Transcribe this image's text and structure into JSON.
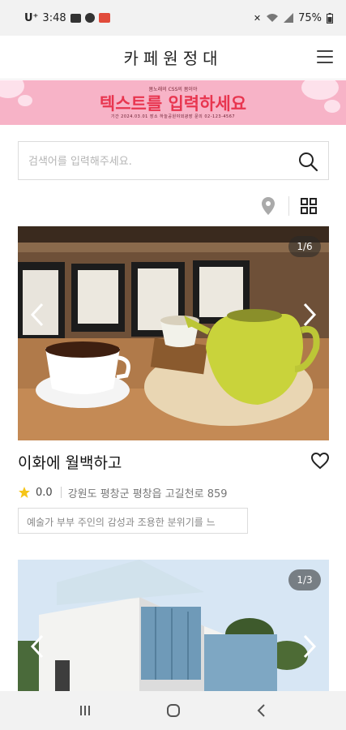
{
  "status_bar": {
    "carrier": "U⁺",
    "time": "3:48",
    "battery": "75%"
  },
  "app": {
    "title": "카페원정대"
  },
  "banner": {
    "top_text": "봄노래의 CSS의 봄이야",
    "headline": "텍스트를 입력하세요",
    "sub_text": "기간 2024.03.01  장소 하늘공원야외광장  문의 02-123-4567",
    "bg_color": "#f7b3c7",
    "headline_color": "#e8354f"
  },
  "search": {
    "placeholder": "검색어를 입력해주세요."
  },
  "toolbar": {
    "location_icon": "location-pin-icon",
    "view_icon": "grid-view-icon"
  },
  "cards": [
    {
      "image_counter": "1/6",
      "name": "이화에 월백하고",
      "rating": "0.0",
      "address": "강원도 평창군 평창읍 고길천로 859",
      "description": "예술가 부부 주인의 감성과 조용한 분위기를 느"
    },
    {
      "image_counter": "1/3"
    }
  ],
  "colors": {
    "star": "#f5c518",
    "accent": "#e8354f"
  }
}
